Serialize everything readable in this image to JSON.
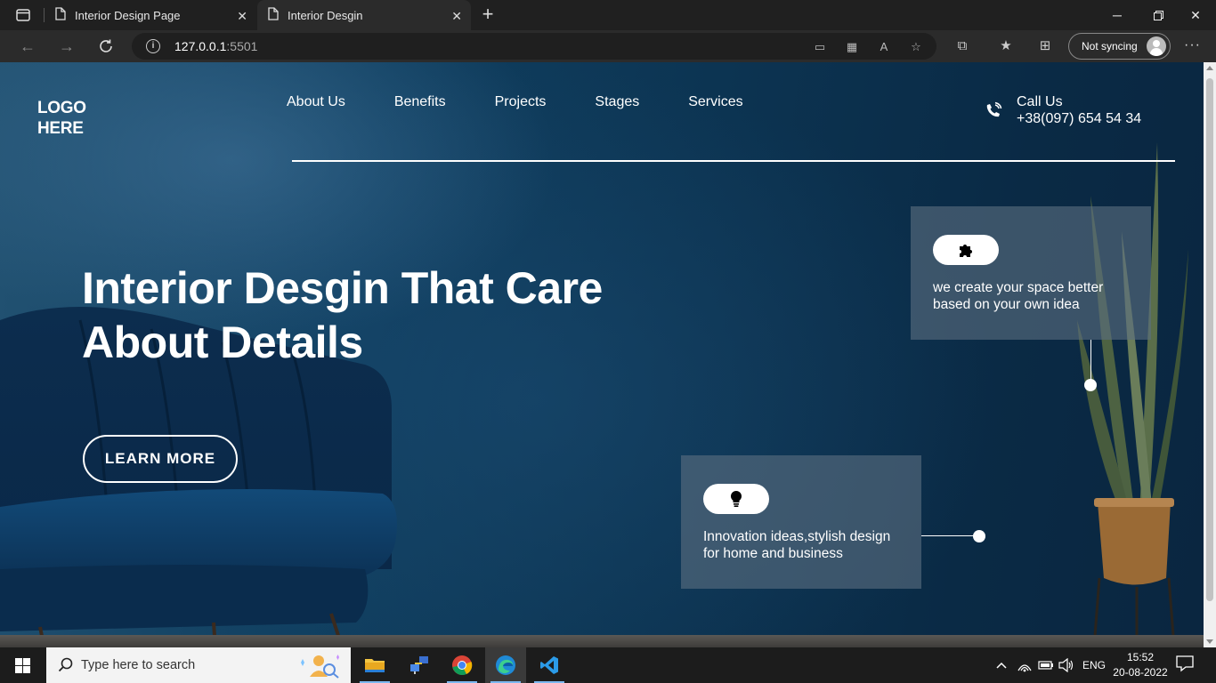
{
  "browser": {
    "tabs": [
      {
        "title": "Interior Design Page"
      },
      {
        "title": "Interior Desgin"
      }
    ],
    "address": {
      "host": "127.0.0.1",
      "port": ":5501"
    },
    "sync_label": "Not syncing"
  },
  "page": {
    "logo": "LOGO HERE",
    "nav": [
      "About Us",
      "Benefits",
      "Projects",
      "Stages",
      "Services"
    ],
    "call": {
      "label": "Call Us",
      "number": "+38(097) 654 54 34"
    },
    "hero": {
      "title": "Interior Desgin That Care About Details",
      "button": "LEARN MORE"
    },
    "cards": [
      {
        "icon": "puzzle-icon",
        "text": "we create your space better based on your own idea"
      },
      {
        "icon": "lightbulb-icon",
        "text": "Innovation ideas,stylish design for home and business"
      }
    ],
    "colors": {
      "background": "#0c3452",
      "card": "#5a6e80",
      "accent": "#ffffff"
    }
  },
  "taskbar": {
    "search_placeholder": "Type here to search",
    "language": "ENG",
    "time": "15:52",
    "date": "20-08-2022",
    "apps": [
      "file-explorer-icon",
      "network-app-icon",
      "chrome-icon",
      "edge-icon",
      "vscode-icon"
    ]
  }
}
